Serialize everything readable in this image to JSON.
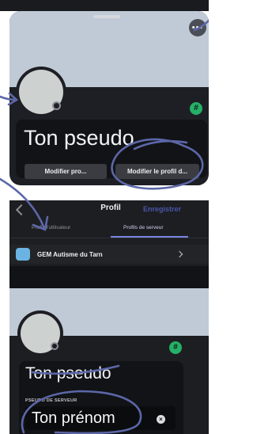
{
  "colors": {
    "banner": "#c0cad6",
    "panel": "#1e1f24",
    "accent_blue": "#7a84e0",
    "boost_green": "#25b067",
    "annotation_ink": "#5c67a8"
  },
  "icons": {
    "more": "more-horizontal-icon",
    "badge": "hash-badge-icon",
    "back": "chevron-left-icon",
    "server_row": "chevron-right-icon",
    "clear": "clear-circle-icon"
  },
  "sheet": {
    "more_label": "•••",
    "badge_label": "#",
    "display_name": "Ton pseudo",
    "buttons": {
      "edit_profile": "Modifier pro...",
      "edit_server_profile": "Modifier le profil d..."
    }
  },
  "edit_screen": {
    "title": "Profil",
    "save_label": "Enregistrer",
    "tabs": [
      "Profil d'utilisateur",
      "Profils de serveur"
    ],
    "active_tab": "Profils de serveur",
    "server": {
      "name": "GEM Autisme du Tarn"
    },
    "badge_label": "#",
    "display_name": "Ton pseudo",
    "field_label": "PSEUDO DE SERVEUR",
    "field_value": "Ton prénom",
    "clear_label": "×"
  }
}
